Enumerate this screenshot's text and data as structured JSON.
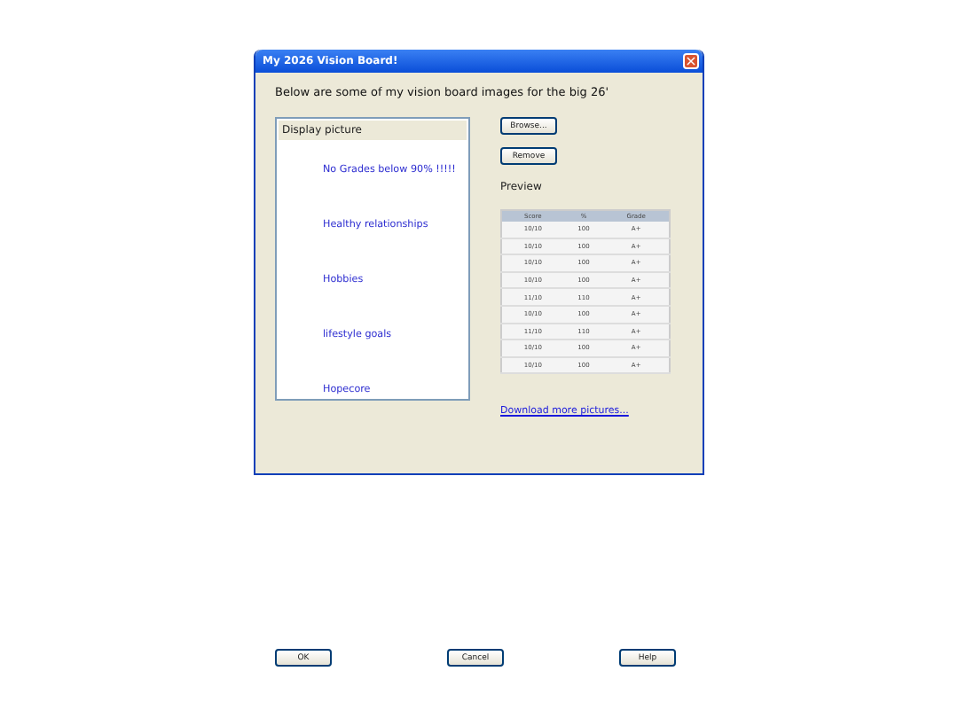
{
  "window": {
    "title": "My 2026 Vision Board!",
    "close": "×"
  },
  "intro": "Below are some of my vision board images for the big 26'",
  "list": {
    "header": "Display picture",
    "items": [
      {
        "label": "No Grades below 90% !!!!!"
      },
      {
        "label": "Healthy relationships"
      },
      {
        "label": "Hobbies"
      },
      {
        "label": "lifestyle goals"
      },
      {
        "label": "Hopecore"
      }
    ]
  },
  "buttons": [
    "Browse...",
    "Remove"
  ],
  "preview": {
    "label": "Preview",
    "table": {
      "columns": [
        "Score",
        "%",
        "Grade"
      ],
      "rows": [
        [
          "10/10",
          "100",
          "A+"
        ],
        [
          "10/10",
          "100",
          "A+"
        ],
        [
          "10/10",
          "100",
          "A+"
        ],
        [
          "10/10",
          "100",
          "A+"
        ],
        [
          "11/10",
          "110",
          "A+"
        ],
        [
          "10/10",
          "100",
          "A+"
        ],
        [
          "11/10",
          "110",
          "A+"
        ],
        [
          "10/10",
          "100",
          "A+"
        ],
        [
          "10/10",
          "100",
          "A+"
        ]
      ]
    }
  },
  "link": "Download more pictures...",
  "footer_buttons": [
    "OK",
    "Cancel",
    "Help"
  ]
}
